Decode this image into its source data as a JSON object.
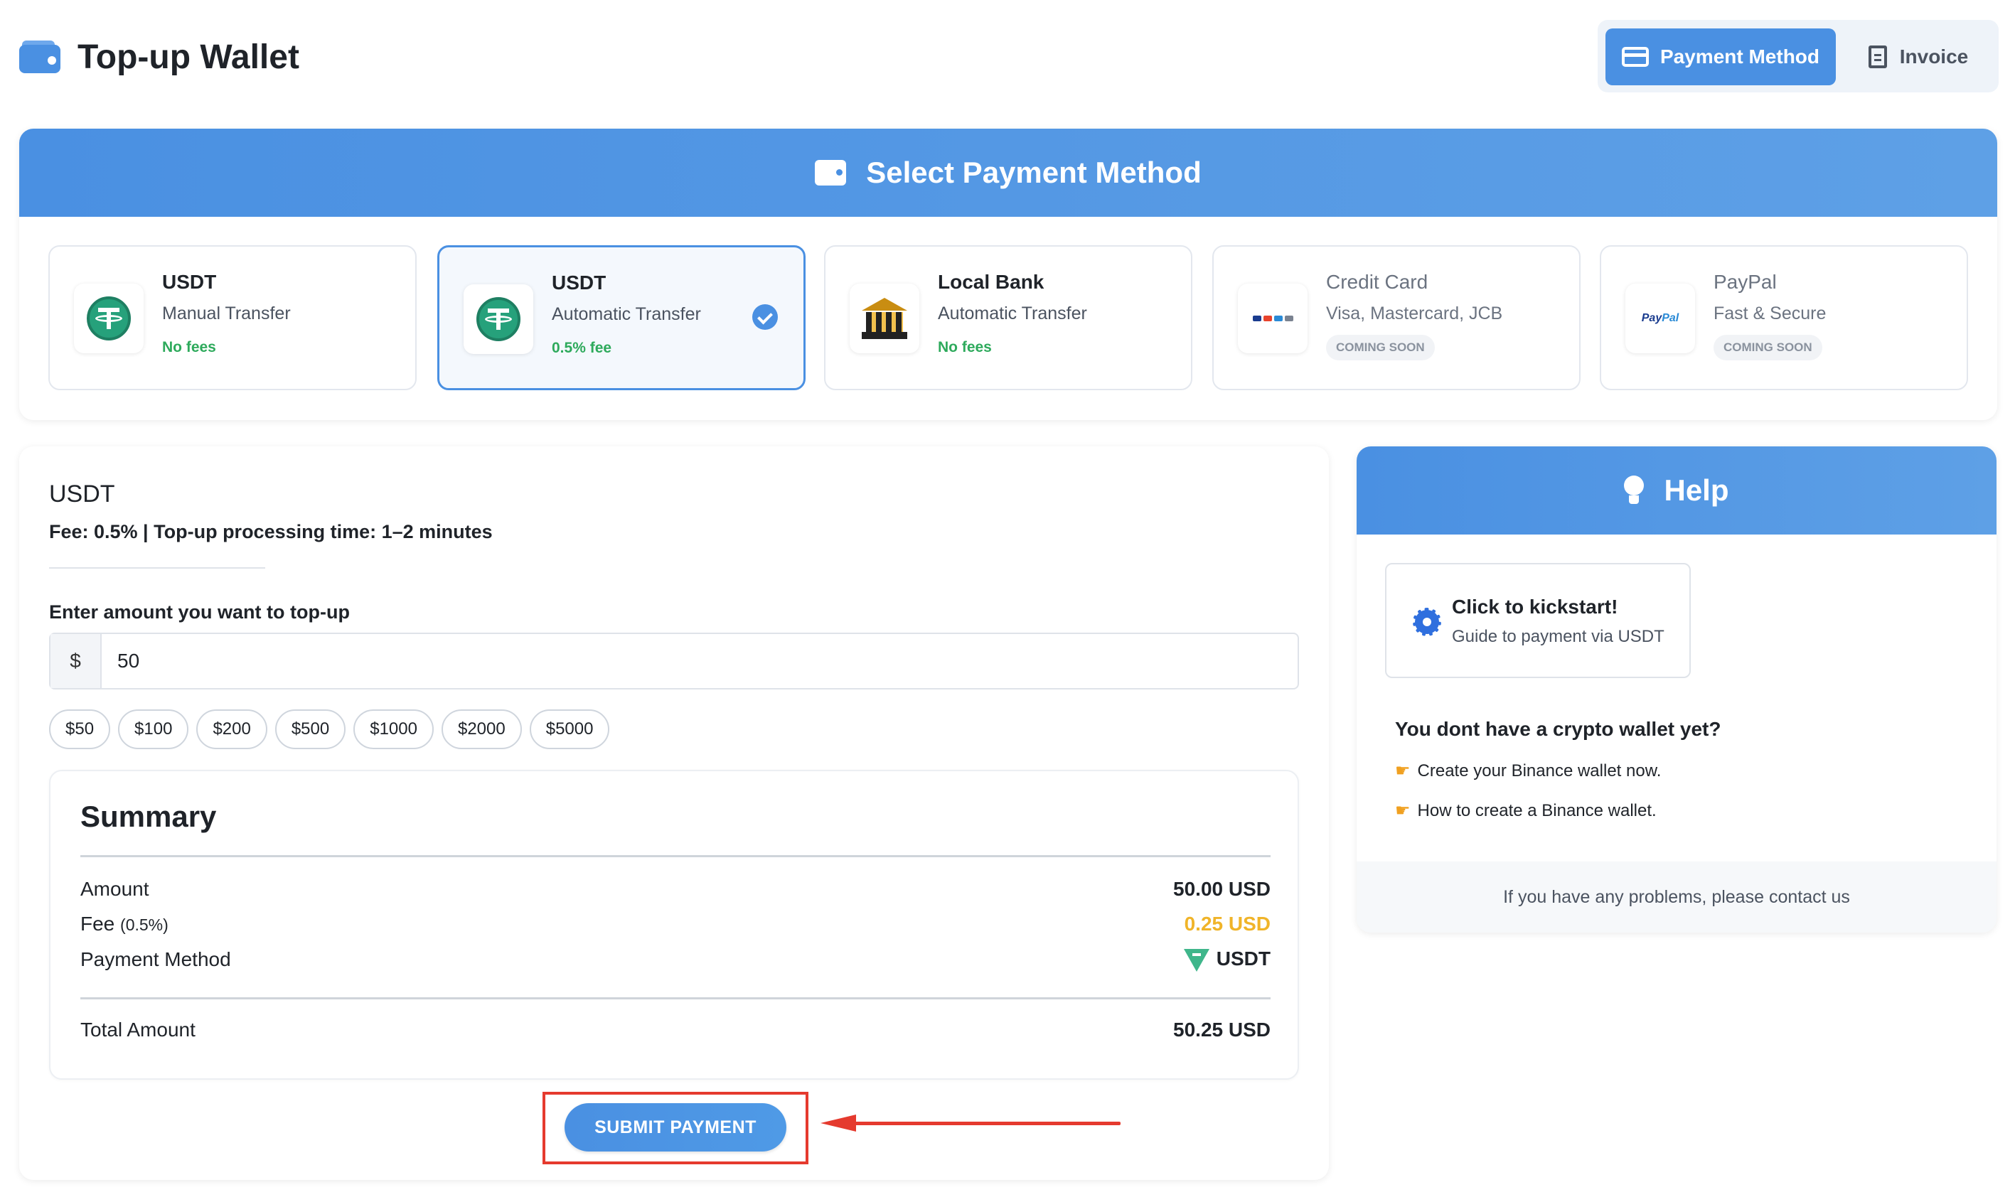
{
  "header": {
    "title": "Top-up Wallet",
    "tabs": [
      {
        "label": "Payment Method",
        "icon": "card-icon",
        "active": true
      },
      {
        "label": "Invoice",
        "icon": "document-icon",
        "active": false
      }
    ]
  },
  "methods": {
    "heading": "Select Payment Method",
    "options": [
      {
        "title": "USDT",
        "subtitle": "Manual Transfer",
        "note": "No fees",
        "icon": "tether-icon"
      },
      {
        "title": "USDT",
        "subtitle": "Automatic Transfer",
        "note": "0.5% fee",
        "icon": "tether-icon",
        "selected": true
      },
      {
        "title": "Local Bank",
        "subtitle": "Automatic Transfer",
        "note": "No fees",
        "icon": "bank-icon"
      },
      {
        "title": "Credit Card",
        "subtitle": "Visa, Mastercard, JCB",
        "badge": "COMING SOON",
        "icon": "credit-cards-icon"
      },
      {
        "title": "PayPal",
        "subtitle": "Fast & Secure",
        "badge": "COMING SOON",
        "icon": "paypal-icon"
      }
    ],
    "paypal_logo": {
      "pay": "Pay",
      "pal": "Pal"
    }
  },
  "form": {
    "title": "USDT",
    "fee_line": "Fee: 0.5% | Top-up processing time: 1–2 minutes",
    "amount_label": "Enter amount you want to top-up",
    "currency_symbol": "$",
    "amount_value": "50",
    "presets": [
      "$50",
      "$100",
      "$200",
      "$500",
      "$1000",
      "$2000",
      "$5000"
    ],
    "submit_label": "SUBMIT PAYMENT"
  },
  "summary": {
    "title": "Summary",
    "amount_label": "Amount",
    "amount_value": "50.00 USD",
    "fee_label": "Fee",
    "fee_pct": "(0.5%)",
    "fee_value": "0.25 USD",
    "method_label": "Payment Method",
    "method_value": "USDT",
    "total_label": "Total Amount",
    "total_value": "50.25 USD"
  },
  "help": {
    "heading": "Help",
    "kickstart_title": "Click to kickstart!",
    "kickstart_sub": "Guide to payment via USDT",
    "question": "You dont have a crypto wallet yet?",
    "links": [
      "Create your Binance wallet now.",
      "How to create a Binance wallet."
    ],
    "footer": "If you have any problems, please contact us"
  },
  "colors": {
    "accent": "#4a90e2",
    "success": "#2eaa5c",
    "warning": "#f0b429",
    "annotation": "#e53a2e"
  }
}
